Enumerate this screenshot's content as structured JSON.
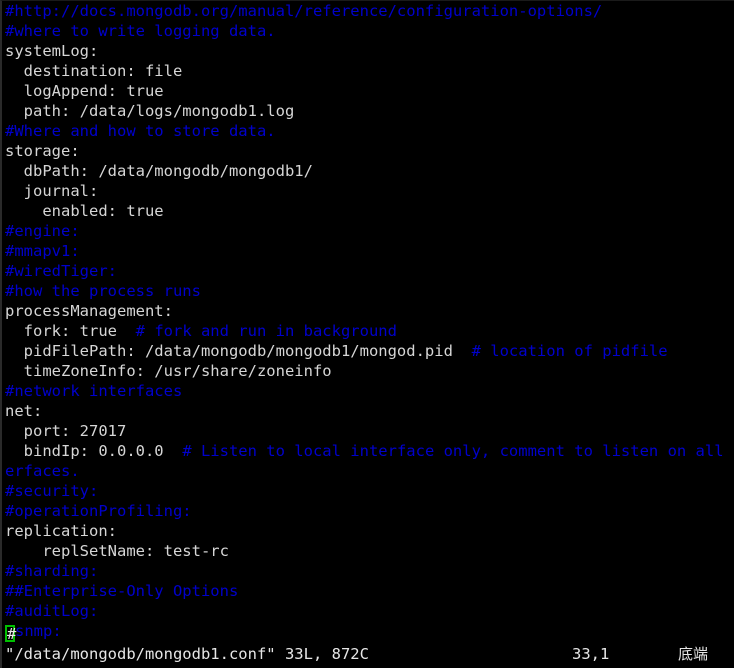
{
  "terminal": {
    "colors": {
      "background": "#000000",
      "foreground": "#d6d6d6",
      "comment": "#0000cc",
      "cursor": "#00c000"
    }
  },
  "editor": {
    "name": "vim",
    "lines": [
      {
        "segments": [
          {
            "text": "#http://docs.mongodb.org/manual/reference/configuration-options/",
            "style": "comment"
          }
        ]
      },
      {
        "segments": [
          {
            "text": "#where to write logging data.",
            "style": "comment"
          }
        ]
      },
      {
        "segments": [
          {
            "text": "systemLog:",
            "style": "plain"
          }
        ]
      },
      {
        "segments": [
          {
            "text": "  destination: file",
            "style": "plain"
          }
        ]
      },
      {
        "segments": [
          {
            "text": "  logAppend: true",
            "style": "plain"
          }
        ]
      },
      {
        "segments": [
          {
            "text": "  path: /data/logs/mongodb1.log",
            "style": "plain"
          }
        ]
      },
      {
        "segments": [
          {
            "text": "#Where and how to store data.",
            "style": "comment"
          }
        ]
      },
      {
        "segments": [
          {
            "text": "storage:",
            "style": "plain"
          }
        ]
      },
      {
        "segments": [
          {
            "text": "  dbPath: /data/mongodb/mongodb1/",
            "style": "plain"
          }
        ]
      },
      {
        "segments": [
          {
            "text": "  journal:",
            "style": "plain"
          }
        ]
      },
      {
        "segments": [
          {
            "text": "    enabled: true",
            "style": "plain"
          }
        ]
      },
      {
        "segments": [
          {
            "text": "#engine:",
            "style": "comment"
          }
        ]
      },
      {
        "segments": [
          {
            "text": "#mmapv1:",
            "style": "comment"
          }
        ]
      },
      {
        "segments": [
          {
            "text": "#wiredTiger:",
            "style": "comment"
          }
        ]
      },
      {
        "segments": [
          {
            "text": "#how the process runs",
            "style": "comment"
          }
        ]
      },
      {
        "segments": [
          {
            "text": "processManagement:",
            "style": "plain"
          }
        ]
      },
      {
        "segments": [
          {
            "text": "  fork: true  ",
            "style": "plain"
          },
          {
            "text": "# fork and run in background",
            "style": "comment"
          }
        ]
      },
      {
        "segments": [
          {
            "text": "  pidFilePath: /data/mongodb/mongodb1/mongod.pid  ",
            "style": "plain"
          },
          {
            "text": "# location of pidfile",
            "style": "comment"
          }
        ]
      },
      {
        "segments": [
          {
            "text": "  timeZoneInfo: /usr/share/zoneinfo",
            "style": "plain"
          }
        ]
      },
      {
        "segments": [
          {
            "text": "#network interfaces",
            "style": "comment"
          }
        ]
      },
      {
        "segments": [
          {
            "text": "net:",
            "style": "plain"
          }
        ]
      },
      {
        "segments": [
          {
            "text": "  port: 27017",
            "style": "plain"
          }
        ]
      },
      {
        "segments": [
          {
            "text": "  bindIp: 0.0.0.0  ",
            "style": "plain"
          },
          {
            "text": "# Listen to local interface only, comment to listen on all int",
            "style": "comment"
          }
        ]
      },
      {
        "segments": [
          {
            "text": "erfaces.",
            "style": "comment"
          }
        ]
      },
      {
        "segments": [
          {
            "text": "#security:",
            "style": "comment"
          }
        ]
      },
      {
        "segments": [
          {
            "text": "#operationProfiling:",
            "style": "comment"
          }
        ]
      },
      {
        "segments": [
          {
            "text": "replication:",
            "style": "plain"
          }
        ]
      },
      {
        "segments": [
          {
            "text": "    replSetName: test-rc",
            "style": "plain"
          }
        ]
      },
      {
        "segments": [
          {
            "text": "#sharding:",
            "style": "comment"
          }
        ]
      },
      {
        "segments": [
          {
            "text": "##Enterprise-Only Options",
            "style": "comment"
          }
        ]
      },
      {
        "segments": [
          {
            "text": "#auditLog:",
            "style": "comment"
          }
        ]
      },
      {
        "cursor": {
          "char": "#",
          "index": 0
        },
        "segments": [
          {
            "text": "snmp:",
            "style": "comment"
          }
        ]
      }
    ]
  },
  "statusline": {
    "file_info": "\"/data/mongodb/mongodb1.conf\" 33L, 872C",
    "position": "33,1",
    "state": "底端"
  }
}
